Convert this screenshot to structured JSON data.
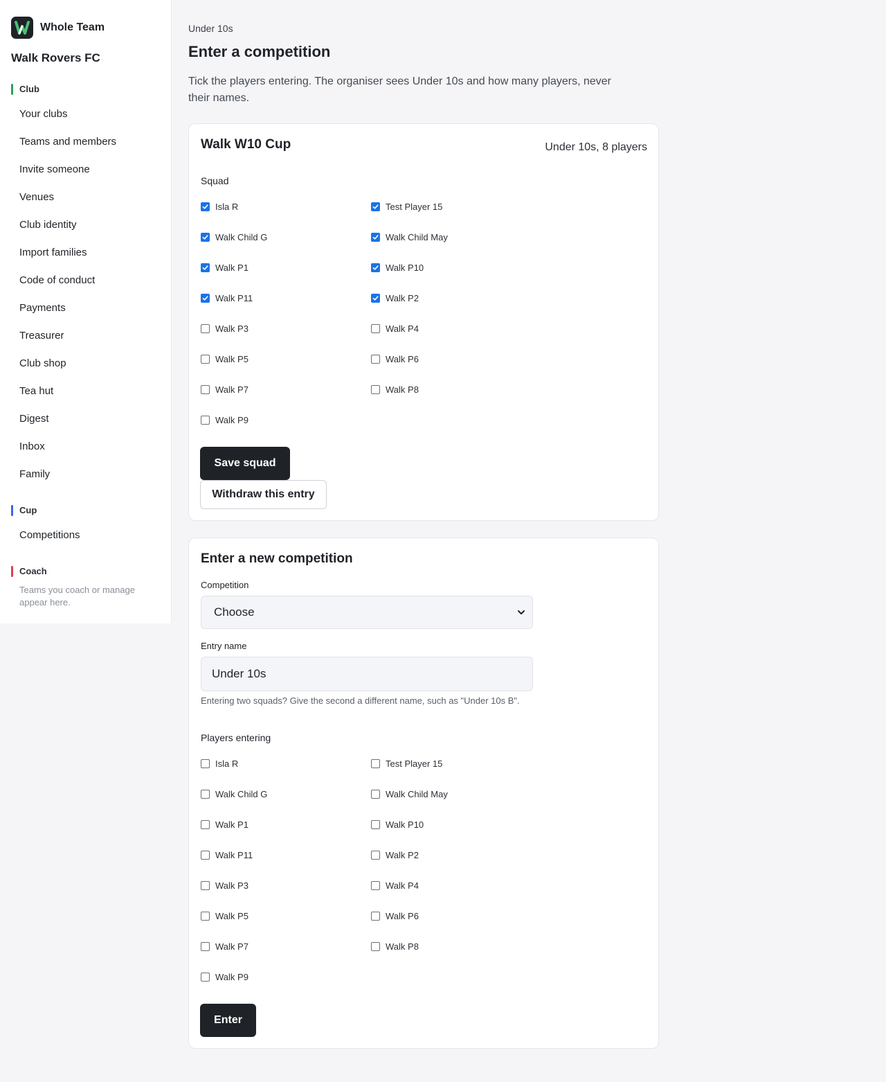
{
  "brand": {
    "name": "Whole Team"
  },
  "club_name": "Walk Rovers FC",
  "sidebar": {
    "sections": [
      {
        "label": "Club",
        "color": "#2e9e5b",
        "items": [
          "Your clubs",
          "Teams and members",
          "Invite someone",
          "Venues",
          "Club identity",
          "Import families",
          "Code of conduct",
          "Payments",
          "Treasurer",
          "Club shop",
          "Tea hut",
          "Digest",
          "Inbox",
          "Family"
        ]
      },
      {
        "label": "Cup",
        "color": "#3a66e0",
        "items": [
          "Competitions"
        ]
      },
      {
        "label": "Coach",
        "color": "#e0404b",
        "items": [],
        "note": "Teams you coach or manage appear here."
      }
    ]
  },
  "page": {
    "breadcrumb": "Under 10s",
    "title": "Enter a competition",
    "intro": "Tick the players entering. The organiser sees Under 10s and how many players, never their names."
  },
  "entry_card": {
    "title": "Walk W10 Cup",
    "meta": "Under 10s, 8 players",
    "squad_label": "Squad",
    "players": [
      {
        "name": "Isla R",
        "checked": true
      },
      {
        "name": "Test Player 15",
        "checked": true
      },
      {
        "name": "Walk Child G",
        "checked": true
      },
      {
        "name": "Walk Child May",
        "checked": true
      },
      {
        "name": "Walk P1",
        "checked": true
      },
      {
        "name": "Walk P10",
        "checked": true
      },
      {
        "name": "Walk P11",
        "checked": true
      },
      {
        "name": "Walk P2",
        "checked": true
      },
      {
        "name": "Walk P3",
        "checked": false
      },
      {
        "name": "Walk P4",
        "checked": false
      },
      {
        "name": "Walk P5",
        "checked": false
      },
      {
        "name": "Walk P6",
        "checked": false
      },
      {
        "name": "Walk P7",
        "checked": false
      },
      {
        "name": "Walk P8",
        "checked": false
      },
      {
        "name": "Walk P9",
        "checked": false
      }
    ],
    "save_label": "Save squad",
    "withdraw_label": "Withdraw this entry"
  },
  "new_card": {
    "title": "Enter a new competition",
    "competition_label": "Competition",
    "competition_value": "Choose",
    "entry_name_label": "Entry name",
    "entry_name_value": "Under 10s",
    "hint": "Entering two squads? Give the second a different name, such as \"Under 10s B\".",
    "players_label": "Players entering",
    "players": [
      {
        "name": "Isla R",
        "checked": false
      },
      {
        "name": "Test Player 15",
        "checked": false
      },
      {
        "name": "Walk Child G",
        "checked": false
      },
      {
        "name": "Walk Child May",
        "checked": false
      },
      {
        "name": "Walk P1",
        "checked": false
      },
      {
        "name": "Walk P10",
        "checked": false
      },
      {
        "name": "Walk P11",
        "checked": false
      },
      {
        "name": "Walk P2",
        "checked": false
      },
      {
        "name": "Walk P3",
        "checked": false
      },
      {
        "name": "Walk P4",
        "checked": false
      },
      {
        "name": "Walk P5",
        "checked": false
      },
      {
        "name": "Walk P6",
        "checked": false
      },
      {
        "name": "Walk P7",
        "checked": false
      },
      {
        "name": "Walk P8",
        "checked": false
      },
      {
        "name": "Walk P9",
        "checked": false
      }
    ],
    "enter_label": "Enter"
  }
}
